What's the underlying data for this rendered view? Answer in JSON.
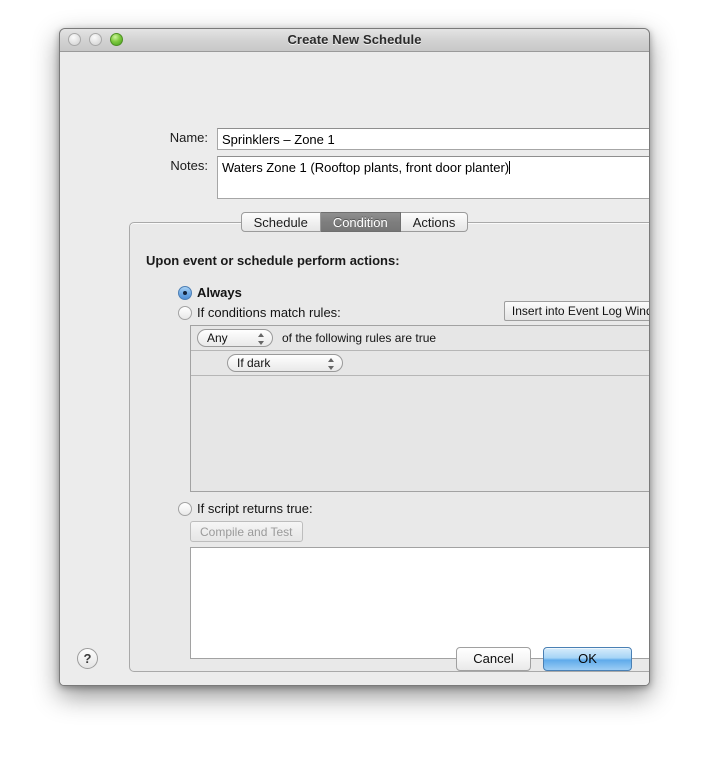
{
  "window": {
    "title": "Create New Schedule",
    "traffic_lights": [
      "close",
      "minimize",
      "zoom"
    ]
  },
  "form": {
    "name_label": "Name:",
    "name_value": "Sprinklers – Zone 1",
    "notes_label": "Notes:",
    "notes_value": "Waters Zone 1 (Rooftop plants, front door planter)"
  },
  "tabs": [
    {
      "label": "Schedule",
      "selected": false
    },
    {
      "label": "Condition",
      "selected": true
    },
    {
      "label": "Actions",
      "selected": false
    }
  ],
  "condition_panel": {
    "heading": "Upon event or schedule perform actions:",
    "options": [
      {
        "label": "Always",
        "selected": true
      },
      {
        "label": "If conditions match rules:",
        "selected": false
      },
      {
        "label": "If script returns true:",
        "selected": false
      }
    ],
    "insert_log_button": "Insert into Event Log Window",
    "rules": {
      "match_popup_value": "Any",
      "match_text": "of the following rules are true",
      "add_rule_icon": "plus-icon",
      "items": [
        {
          "popup_value": "If dark",
          "add_icon": "plus-icon"
        }
      ]
    },
    "script": {
      "compile_button": "Compile and Test",
      "compile_enabled": false,
      "content": ""
    }
  },
  "footer": {
    "help_label": "?",
    "cancel_label": "Cancel",
    "ok_label": "OK"
  },
  "colors": {
    "accent": "#5fabeb",
    "selected_tab": "#7e7e7e",
    "radio_on": "#4f8fd6"
  }
}
